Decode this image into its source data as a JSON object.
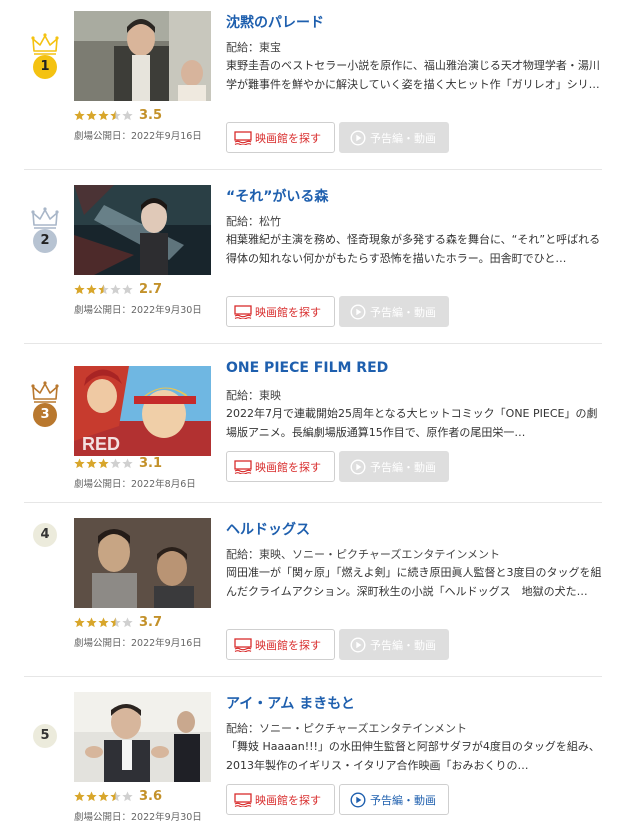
{
  "labels": {
    "find_theater": "映画館を探す",
    "trailer": "予告編・動画"
  },
  "colors": {
    "title_link": "#1e5fae",
    "rating": "#c3912a",
    "theater_button_text": "#d82c2c",
    "rank_gold": "#f4c211",
    "rank_silver": "#b7c3d2",
    "rank_bronze": "#b9782e",
    "rank_plain": "#ecebdc"
  },
  "items": [
    {
      "rank": "1",
      "medal": "gold",
      "title": "沈黙のパレード",
      "distributor": "配給：東宝",
      "synopsis": "東野圭吾のベストセラー小説を原作に、福山雅治演じる天才物理学者・湯川学が難事件を鮮やかに解決していく姿を描く大ヒット作「ガリレオ」シリ…",
      "rating": "3.5",
      "rating_score": 3.5,
      "release_date": "劇場公開日：2022年9月16日",
      "trailer_available": false
    },
    {
      "rank": "2",
      "medal": "silver",
      "title": "“それ”がいる森",
      "distributor": "配給：松竹",
      "synopsis": "相葉雅紀が主演を務め、怪奇現象が多発する森を舞台に、“それ”と呼ばれる得体の知れない何かがもたらす恐怖を描いたホラー。田舎町でひと…",
      "rating": "2.7",
      "rating_score": 2.7,
      "release_date": "劇場公開日：2022年9月30日",
      "trailer_available": false
    },
    {
      "rank": "3",
      "medal": "bronze",
      "title": "ONE PIECE FILM RED",
      "distributor": "配給：東映",
      "synopsis": "2022年7月で連載開始25周年となる大ヒットコミック「ONE PIECE」の劇場版アニメ。長編劇場版通算15作目で、原作者の尾田栄一…",
      "rating": "3.1",
      "rating_score": 3.1,
      "release_date": "劇場公開日：2022年8月6日",
      "trailer_available": false
    },
    {
      "rank": "4",
      "medal": "plain",
      "title": "ヘルドッグス",
      "distributor": "配給：東映、ソニー・ピクチャーズエンタテインメント",
      "synopsis": "岡田准一が「関ヶ原」「燃えよ剣」に続き原田眞人監督と3度目のタッグを組んだクライムアクション。深町秋生の小説「ヘルドッグス　地獄の犬た…",
      "rating": "3.7",
      "rating_score": 3.7,
      "release_date": "劇場公開日：2022年9月16日",
      "trailer_available": false
    },
    {
      "rank": "5",
      "medal": "plain",
      "title": "アイ・アム まきもと",
      "distributor": "配給：ソニー・ピクチャーズエンタテインメント",
      "synopsis": "「舞妓 Haaaan!!!」の水田伸生監督と阿部サダヲが4度目のタッグを組み、2013年製作のイギリス・イタリア合作映画「おみおくりの…",
      "rating": "3.6",
      "rating_score": 3.6,
      "release_date": "劇場公開日：2022年9月30日",
      "trailer_available": true
    }
  ]
}
